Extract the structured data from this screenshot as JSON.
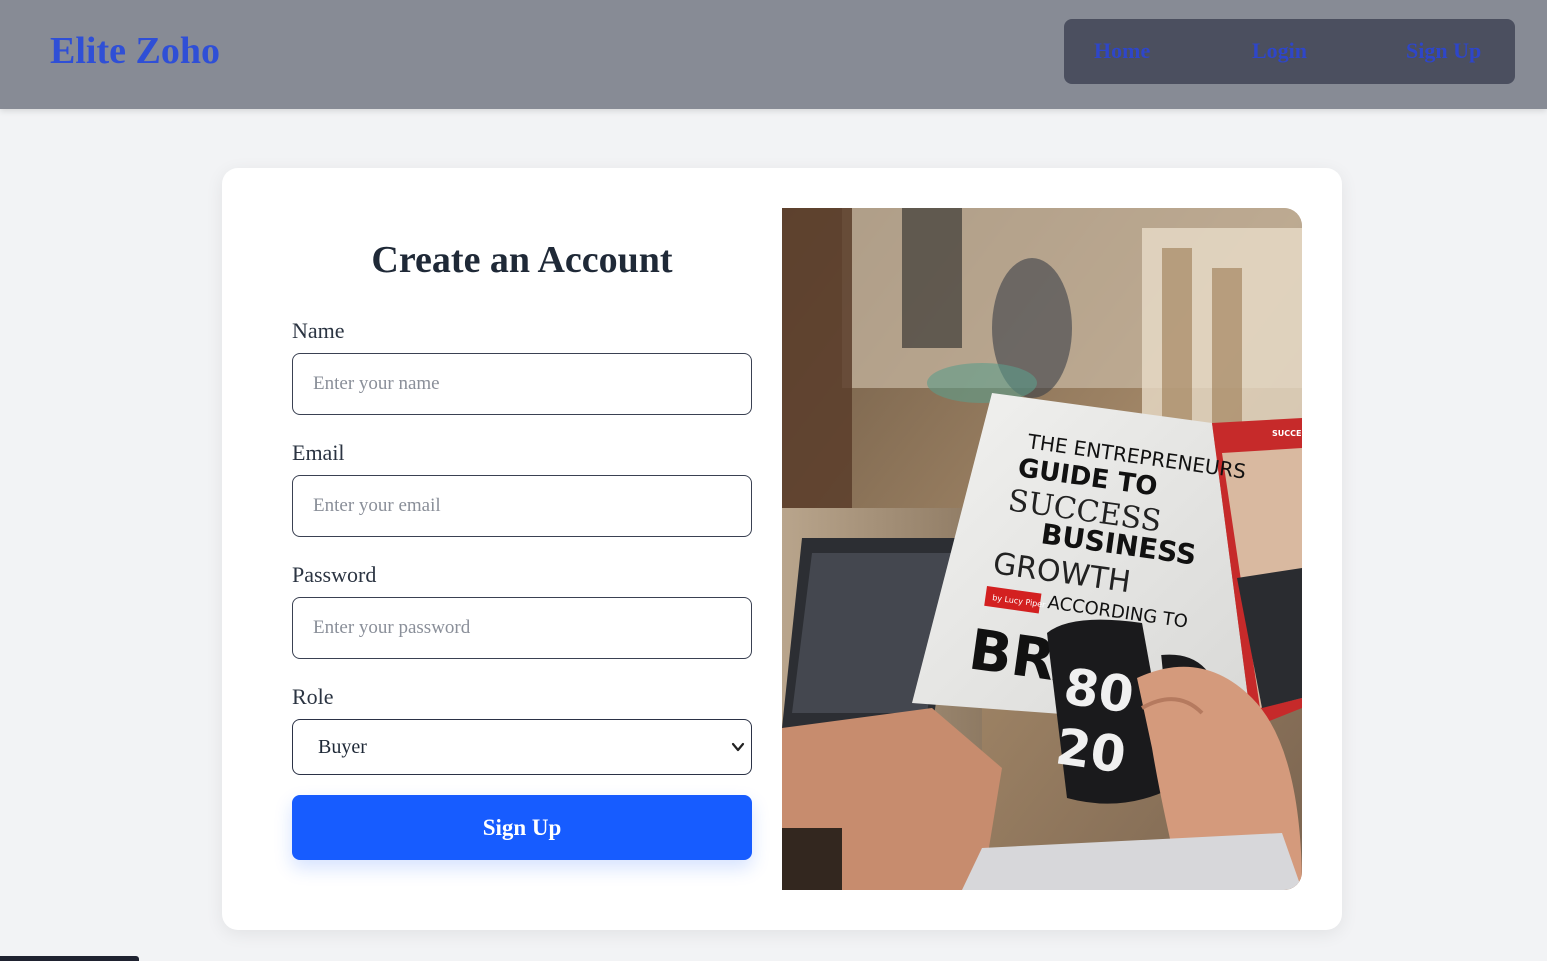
{
  "header": {
    "brand": "Elite Zoho",
    "nav": {
      "home": "Home",
      "login": "Login",
      "signup": "Sign Up"
    }
  },
  "form": {
    "title": "Create an Account",
    "name": {
      "label": "Name",
      "placeholder": "Enter your name"
    },
    "email": {
      "label": "Email",
      "placeholder": "Enter your email"
    },
    "password": {
      "label": "Password",
      "placeholder": "Enter your password"
    },
    "role": {
      "label": "Role",
      "selected": "Buyer"
    },
    "submit_label": "Sign Up"
  },
  "image": {
    "magazine_line1": "THE ENTREPRENEURS",
    "magazine_line2": "GUIDE TO",
    "magazine_line3": "SUCCESS",
    "magazine_line4": "BUSINESS",
    "magazine_line5": "GROWTH",
    "magazine_byline": "by Lucy Piper",
    "magazine_line6": "ACCORDING TO",
    "magazine_line7": "BRA",
    "mug_text_top": "80",
    "mug_text_bottom": "20",
    "magazine_corner": "SUCCE"
  },
  "colors": {
    "header_bg": "#878b95",
    "brand": "#2f4fd6",
    "nav_bg": "#4b4f5f",
    "primary_button": "#175cff",
    "page_bg": "#f2f3f5"
  }
}
